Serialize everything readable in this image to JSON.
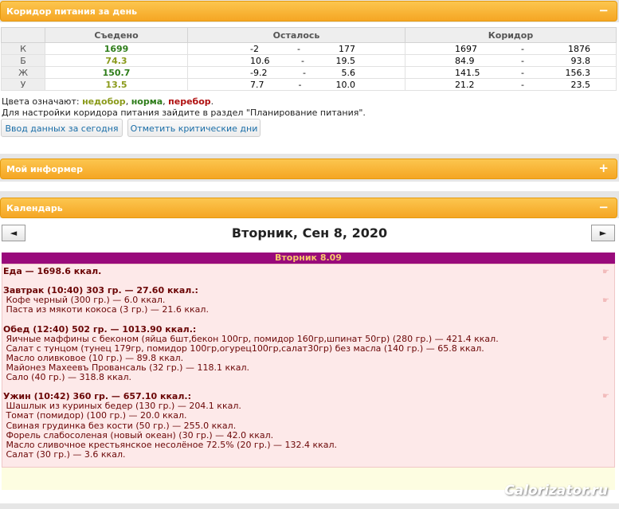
{
  "corridor_panel": {
    "title": "Коридор питания за день",
    "toggle": "−"
  },
  "table": {
    "headers": [
      "Съедено",
      "Осталось",
      "Коридор"
    ],
    "rows": [
      {
        "label": "К",
        "eaten": "1699",
        "eaten_color": "#2e7d1a",
        "left_min": "-2",
        "left_sep": "-",
        "left_max": "177",
        "cor_min": "1697",
        "cor_sep": "-",
        "cor_max": "1876"
      },
      {
        "label": "Б",
        "eaten": "74.3",
        "eaten_color": "#8a9a1a",
        "left_min": "10.6",
        "left_sep": "-",
        "left_max": "19.5",
        "cor_min": "84.9",
        "cor_sep": "-",
        "cor_max": "93.8"
      },
      {
        "label": "Ж",
        "eaten": "150.7",
        "eaten_color": "#2e7d1a",
        "left_min": "-9.2",
        "left_sep": "-",
        "left_max": "5.6",
        "cor_min": "141.5",
        "cor_sep": "-",
        "cor_max": "156.3"
      },
      {
        "label": "У",
        "eaten": "13.5",
        "eaten_color": "#8a9a1a",
        "left_min": "7.7",
        "left_sep": "-",
        "left_max": "10.0",
        "cor_min": "21.2",
        "cor_sep": "-",
        "cor_max": "23.5"
      }
    ]
  },
  "legend": {
    "prefix": "Цвета означают: ",
    "under": "недобор",
    "sep1": ", ",
    "norm": "норма",
    "sep2": ", ",
    "over": "перебор",
    "end": ".",
    "hint": "Для настройки коридора питания зайдите в раздел \"Планирование питания\".",
    "colors": {
      "under": "#8a9a1a",
      "norm": "#2e7d1a",
      "over": "#b01010"
    }
  },
  "buttons": {
    "enter_today": "Ввод данных за сегодня",
    "mark_critical": "Отметить критические дни"
  },
  "informer_panel": {
    "title": "Мой информер",
    "toggle": "+"
  },
  "calendar_panel": {
    "title": "Календарь",
    "toggle": "−"
  },
  "calendar": {
    "prev": "◄",
    "next": "►",
    "date_title": "Вторник, Сен 8, 2020",
    "day_label": "Вторник 8.09",
    "lines": [
      "Еда — 1698.6 ккал.",
      "",
      "Завтрак (10:40) 303 гр. — 27.60 ккал.:",
      " Кофе черный (300 гр.) — 6.0 ккал.",
      " Паста из мякоти кокоса (3 гр.) — 21.6 ккал.",
      "",
      "Обед (12:40) 502 гр. — 1013.90 ккал.:",
      " Яичные маффины с беконом (яйца 6шт,бекон 100гр, помидор 160гр,шпинат 50гр) (280 гр.) — 421.4 ккал.",
      " Салат с тунцом (тунец 179гр, помидор 100гр,огурец100гр,салат30гр) без масла (140 гр.) — 65.8 ккал.",
      " Масло оливковое (10 гр.) — 89.8 ккал.",
      " Майонез Махеевъ Провансаль (32 гр.) — 118.1 ккал.",
      " Сало (40 гр.) — 318.8 ккал.",
      "",
      "Ужин (10:42) 360 гр. — 657.10 ккал.:",
      " Шашлык из куриных бедер (130 гр.) — 204.1 ккал.",
      " Томат (помидор) (100 гр.) — 20.0 ккал.",
      " Свиная грудинка без кости (50 гр.) — 255.0 ккал.",
      " Форель слабосоленая (новый океан) (30 гр.) — 42.0 ккал.",
      " Масло сливочное крестьянское несолёное 72.5% (20 гр.) — 132.4 ккал.",
      " Салат (30 гр.) — 3.6 ккал."
    ]
  },
  "watermark": "Calorizator.ru"
}
